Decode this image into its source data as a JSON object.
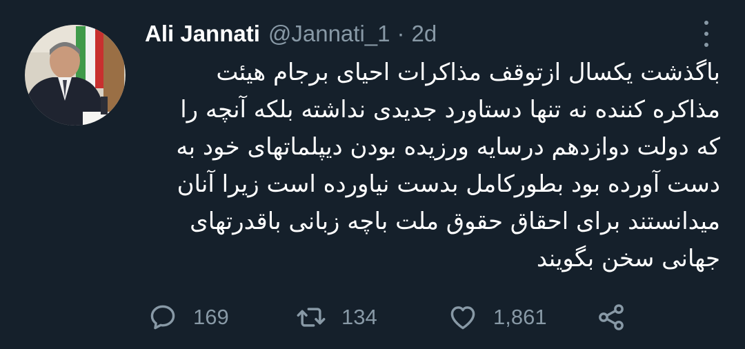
{
  "tweet": {
    "author": {
      "display_name": "Ali Jannati",
      "handle": "@Jannati_1",
      "separator": "·",
      "time": "2d"
    },
    "text_lines": [
      "باگذشت یکسال ازتوقف مذاکرات احیای برجام هیئت",
      "مذاکره کننده نه تنها دستاورد جدیدی نداشته بلکه آنچه را",
      "که دولت دوازدهم درسایه ورزیده بودن دیپلماتهای خود به",
      "دست آورده بود بطورکامل بدست نیاورده است زیرا آنان",
      "میدانستند برای احقاق حقوق ملت باچه زبانی باقدرتهای",
      "جهانی سخن بگویند"
    ],
    "stats": {
      "replies": "169",
      "retweets": "134",
      "likes": "1,861"
    }
  },
  "icons": {
    "reply": "reply-icon",
    "retweet": "retweet-icon",
    "like": "heart-icon",
    "share": "share-icon",
    "more": "more-options-icon"
  },
  "colors": {
    "background": "#15202b",
    "primary_text": "#ffffff",
    "secondary_text": "#8899a6"
  }
}
